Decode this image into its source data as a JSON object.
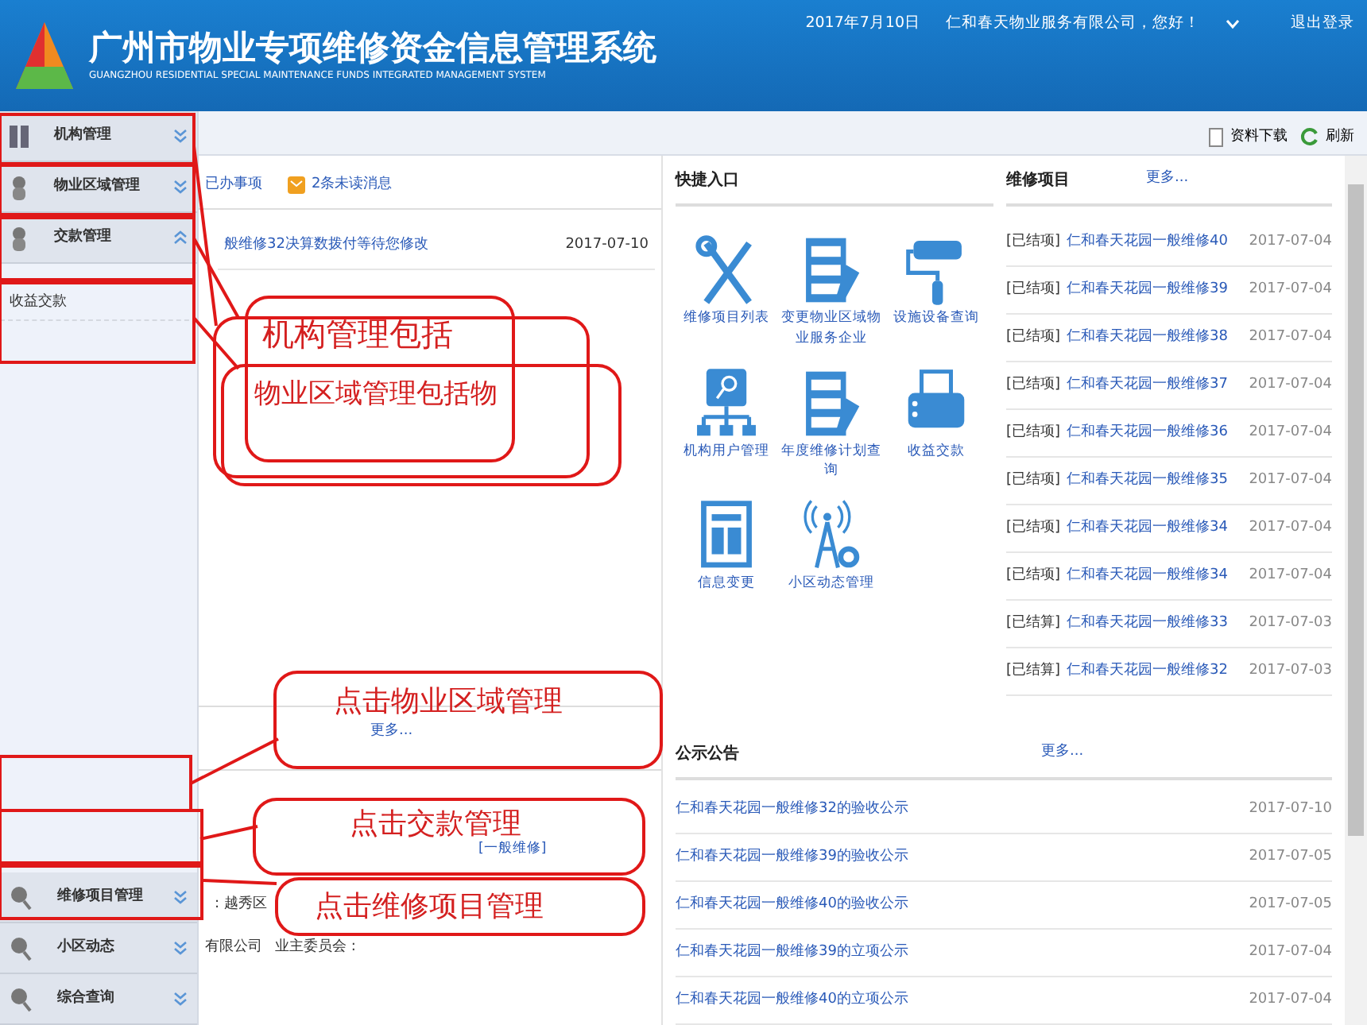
{
  "header": {
    "title": "广州市物业专项维修资金信息管理系统",
    "subtitle": "GUANGZHOU RESIDENTIAL SPECIAL MAINTENANCE FUNDS INTEGRATED MANAGEMENT SYSTEM",
    "date": "2017年7月10日",
    "greeting": "仁和春天物业服务有限公司，您好！",
    "logout": "退出登录"
  },
  "sidebar": {
    "top_items": [
      {
        "label": "机构管理",
        "kind": "bars",
        "expanded": false
      },
      {
        "label": "物业区域管理",
        "kind": "person",
        "expanded": false
      },
      {
        "label": "交款管理",
        "kind": "person",
        "expanded": true,
        "children": [
          {
            "label": "收益交款"
          }
        ]
      }
    ],
    "bottom_items": [
      {
        "label": "维修项目管理",
        "kind": "magnifier",
        "expanded": false
      },
      {
        "label": "小区动态",
        "kind": "magnifier",
        "expanded": false
      },
      {
        "label": "综合查询",
        "kind": "magnifier",
        "expanded": false
      }
    ]
  },
  "toolbar": [
    {
      "label": "资料下载",
      "kind": "download"
    },
    {
      "label": "刷新",
      "kind": "refresh"
    }
  ],
  "tasks": {
    "tabs": [
      {
        "label": "已办事项",
        "kind": "done"
      },
      {
        "label": "2条未读消息",
        "kind": "mail"
      }
    ],
    "messages": [
      {
        "text": "般维修32决算数拨付等待您修改",
        "date": "2017-07-10"
      }
    ],
    "more": "更多..."
  },
  "lower_panel": {
    "texts": [
      {
        "text": "[一般维修]",
        "kind": "link"
      },
      {
        "text": ": 越秀区",
        "kind": "plain"
      },
      {
        "text": "有限公司",
        "kind": "plain"
      },
      {
        "text": "业主委员会 :",
        "kind": "plain"
      }
    ]
  },
  "quick_entry": {
    "title": "快捷入口",
    "items": [
      {
        "label": "维修项目列表",
        "kind": "tools"
      },
      {
        "label": "变更物业区域物业服务企业",
        "kind": "server"
      },
      {
        "label": "设施设备查询",
        "kind": "roller"
      },
      {
        "label": "机构用户管理",
        "kind": "network"
      },
      {
        "label": "年度维修计划查询",
        "kind": "server"
      },
      {
        "label": "收益交款",
        "kind": "printer"
      },
      {
        "label": "信息变更",
        "kind": "news"
      },
      {
        "label": "小区动态管理",
        "kind": "antenna"
      }
    ]
  },
  "repairs": {
    "title": "维修项目",
    "more": "更多...",
    "rows": [
      {
        "tag": "[已结项]",
        "text": "仁和春天花园一般维修40",
        "date": "2017-07-04"
      },
      {
        "tag": "[已结项]",
        "text": "仁和春天花园一般维修39",
        "date": "2017-07-04"
      },
      {
        "tag": "[已结项]",
        "text": "仁和春天花园一般维修38",
        "date": "2017-07-04"
      },
      {
        "tag": "[已结项]",
        "text": "仁和春天花园一般维修37",
        "date": "2017-07-04"
      },
      {
        "tag": "[已结项]",
        "text": "仁和春天花园一般维修36",
        "date": "2017-07-04"
      },
      {
        "tag": "[已结项]",
        "text": "仁和春天花园一般维修35",
        "date": "2017-07-04"
      },
      {
        "tag": "[已结项]",
        "text": "仁和春天花园一般维修34",
        "date": "2017-07-04"
      },
      {
        "tag": "[已结项]",
        "text": "仁和春天花园一般维修34",
        "date": "2017-07-04"
      },
      {
        "tag": "[已结算]",
        "text": "仁和春天花园一般维修33",
        "date": "2017-07-03"
      },
      {
        "tag": "[已结算]",
        "text": "仁和春天花园一般维修32",
        "date": "2017-07-03"
      }
    ]
  },
  "notices": {
    "title": "公示公告",
    "more": "更多...",
    "rows": [
      {
        "text": "仁和春天花园一般维修32的验收公示",
        "date": "2017-07-10"
      },
      {
        "text": "仁和春天花园一般维修39的验收公示",
        "date": "2017-07-05"
      },
      {
        "text": "仁和春天花园一般维修40的验收公示",
        "date": "2017-07-05"
      },
      {
        "text": "仁和春天花园一般维修39的立项公示",
        "date": "2017-07-04"
      },
      {
        "text": "仁和春天花园一般维修40的立项公示",
        "date": "2017-07-04"
      }
    ]
  },
  "annotations": {
    "callouts": [
      {
        "text": "机构管理包括"
      },
      {
        "text": "物业区域管理包括物"
      },
      {
        "text": "点击物业区域管理"
      },
      {
        "text": "点击交款管理"
      },
      {
        "text": "点击维修项目管理"
      }
    ]
  }
}
